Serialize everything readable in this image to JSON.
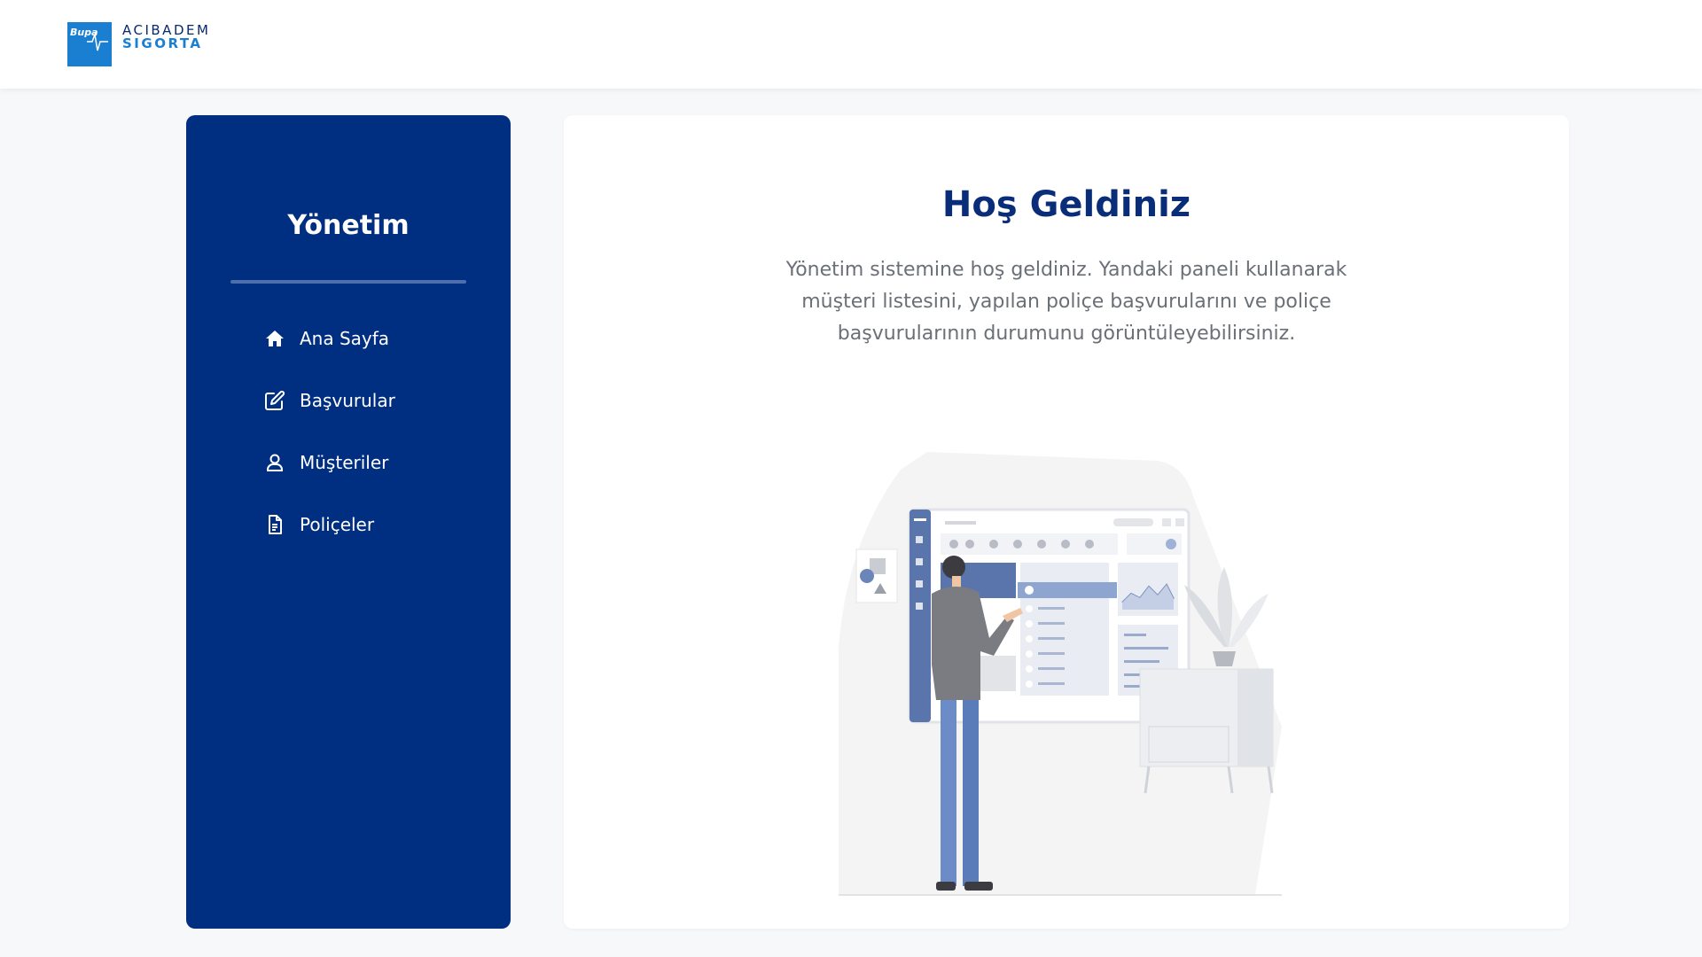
{
  "brand": {
    "badge": "Bupa",
    "name_line1": "ACIBADEM",
    "name_line2": "SIGORTA",
    "colors": {
      "badge": "#1a7fd1",
      "navy": "#002e80",
      "title": "#0a2d7a"
    }
  },
  "sidebar": {
    "title": "Yönetim",
    "items": [
      {
        "label": "Ana Sayfa",
        "icon": "home-icon"
      },
      {
        "label": "Başvurular",
        "icon": "edit-icon"
      },
      {
        "label": "Müşteriler",
        "icon": "user-icon"
      },
      {
        "label": "Poliçeler",
        "icon": "document-icon"
      }
    ]
  },
  "main": {
    "title": "Hoş Geldiniz",
    "description": "Yönetim sistemine hoş geldiniz. Yandaki paneli kullanarak müşteri listesini, yapılan poliçe başvurularını ve poliçe başvurularının durumunu görüntüleyebilirsiniz.",
    "illustration": "dashboard-presenter-illustration"
  }
}
